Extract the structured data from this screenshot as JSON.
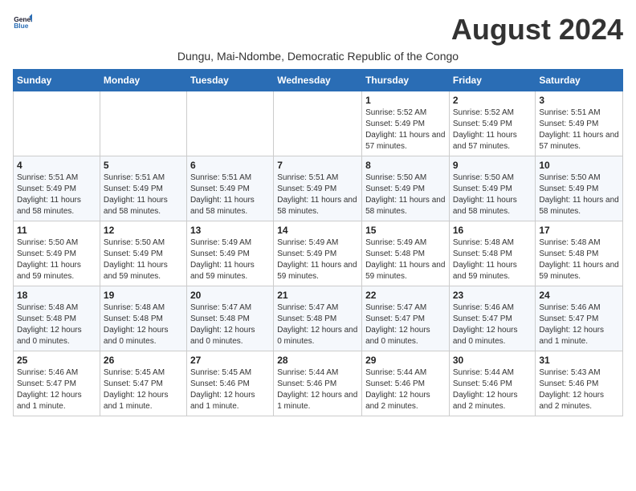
{
  "logo": {
    "line1": "General",
    "line2": "Blue"
  },
  "title": "August 2024",
  "subtitle": "Dungu, Mai-Ndombe, Democratic Republic of the Congo",
  "days_header": [
    "Sunday",
    "Monday",
    "Tuesday",
    "Wednesday",
    "Thursday",
    "Friday",
    "Saturday"
  ],
  "weeks": [
    [
      {
        "day": "",
        "info": ""
      },
      {
        "day": "",
        "info": ""
      },
      {
        "day": "",
        "info": ""
      },
      {
        "day": "",
        "info": ""
      },
      {
        "day": "1",
        "info": "Sunrise: 5:52 AM\nSunset: 5:49 PM\nDaylight: 11 hours and 57 minutes."
      },
      {
        "day": "2",
        "info": "Sunrise: 5:52 AM\nSunset: 5:49 PM\nDaylight: 11 hours and 57 minutes."
      },
      {
        "day": "3",
        "info": "Sunrise: 5:51 AM\nSunset: 5:49 PM\nDaylight: 11 hours and 57 minutes."
      }
    ],
    [
      {
        "day": "4",
        "info": "Sunrise: 5:51 AM\nSunset: 5:49 PM\nDaylight: 11 hours and 58 minutes."
      },
      {
        "day": "5",
        "info": "Sunrise: 5:51 AM\nSunset: 5:49 PM\nDaylight: 11 hours and 58 minutes."
      },
      {
        "day": "6",
        "info": "Sunrise: 5:51 AM\nSunset: 5:49 PM\nDaylight: 11 hours and 58 minutes."
      },
      {
        "day": "7",
        "info": "Sunrise: 5:51 AM\nSunset: 5:49 PM\nDaylight: 11 hours and 58 minutes."
      },
      {
        "day": "8",
        "info": "Sunrise: 5:50 AM\nSunset: 5:49 PM\nDaylight: 11 hours and 58 minutes."
      },
      {
        "day": "9",
        "info": "Sunrise: 5:50 AM\nSunset: 5:49 PM\nDaylight: 11 hours and 58 minutes."
      },
      {
        "day": "10",
        "info": "Sunrise: 5:50 AM\nSunset: 5:49 PM\nDaylight: 11 hours and 58 minutes."
      }
    ],
    [
      {
        "day": "11",
        "info": "Sunrise: 5:50 AM\nSunset: 5:49 PM\nDaylight: 11 hours and 59 minutes."
      },
      {
        "day": "12",
        "info": "Sunrise: 5:50 AM\nSunset: 5:49 PM\nDaylight: 11 hours and 59 minutes."
      },
      {
        "day": "13",
        "info": "Sunrise: 5:49 AM\nSunset: 5:49 PM\nDaylight: 11 hours and 59 minutes."
      },
      {
        "day": "14",
        "info": "Sunrise: 5:49 AM\nSunset: 5:49 PM\nDaylight: 11 hours and 59 minutes."
      },
      {
        "day": "15",
        "info": "Sunrise: 5:49 AM\nSunset: 5:48 PM\nDaylight: 11 hours and 59 minutes."
      },
      {
        "day": "16",
        "info": "Sunrise: 5:48 AM\nSunset: 5:48 PM\nDaylight: 11 hours and 59 minutes."
      },
      {
        "day": "17",
        "info": "Sunrise: 5:48 AM\nSunset: 5:48 PM\nDaylight: 11 hours and 59 minutes."
      }
    ],
    [
      {
        "day": "18",
        "info": "Sunrise: 5:48 AM\nSunset: 5:48 PM\nDaylight: 12 hours and 0 minutes."
      },
      {
        "day": "19",
        "info": "Sunrise: 5:48 AM\nSunset: 5:48 PM\nDaylight: 12 hours and 0 minutes."
      },
      {
        "day": "20",
        "info": "Sunrise: 5:47 AM\nSunset: 5:48 PM\nDaylight: 12 hours and 0 minutes."
      },
      {
        "day": "21",
        "info": "Sunrise: 5:47 AM\nSunset: 5:48 PM\nDaylight: 12 hours and 0 minutes."
      },
      {
        "day": "22",
        "info": "Sunrise: 5:47 AM\nSunset: 5:47 PM\nDaylight: 12 hours and 0 minutes."
      },
      {
        "day": "23",
        "info": "Sunrise: 5:46 AM\nSunset: 5:47 PM\nDaylight: 12 hours and 0 minutes."
      },
      {
        "day": "24",
        "info": "Sunrise: 5:46 AM\nSunset: 5:47 PM\nDaylight: 12 hours and 1 minute."
      }
    ],
    [
      {
        "day": "25",
        "info": "Sunrise: 5:46 AM\nSunset: 5:47 PM\nDaylight: 12 hours and 1 minute."
      },
      {
        "day": "26",
        "info": "Sunrise: 5:45 AM\nSunset: 5:47 PM\nDaylight: 12 hours and 1 minute."
      },
      {
        "day": "27",
        "info": "Sunrise: 5:45 AM\nSunset: 5:46 PM\nDaylight: 12 hours and 1 minute."
      },
      {
        "day": "28",
        "info": "Sunrise: 5:44 AM\nSunset: 5:46 PM\nDaylight: 12 hours and 1 minute."
      },
      {
        "day": "29",
        "info": "Sunrise: 5:44 AM\nSunset: 5:46 PM\nDaylight: 12 hours and 2 minutes."
      },
      {
        "day": "30",
        "info": "Sunrise: 5:44 AM\nSunset: 5:46 PM\nDaylight: 12 hours and 2 minutes."
      },
      {
        "day": "31",
        "info": "Sunrise: 5:43 AM\nSunset: 5:46 PM\nDaylight: 12 hours and 2 minutes."
      }
    ]
  ]
}
